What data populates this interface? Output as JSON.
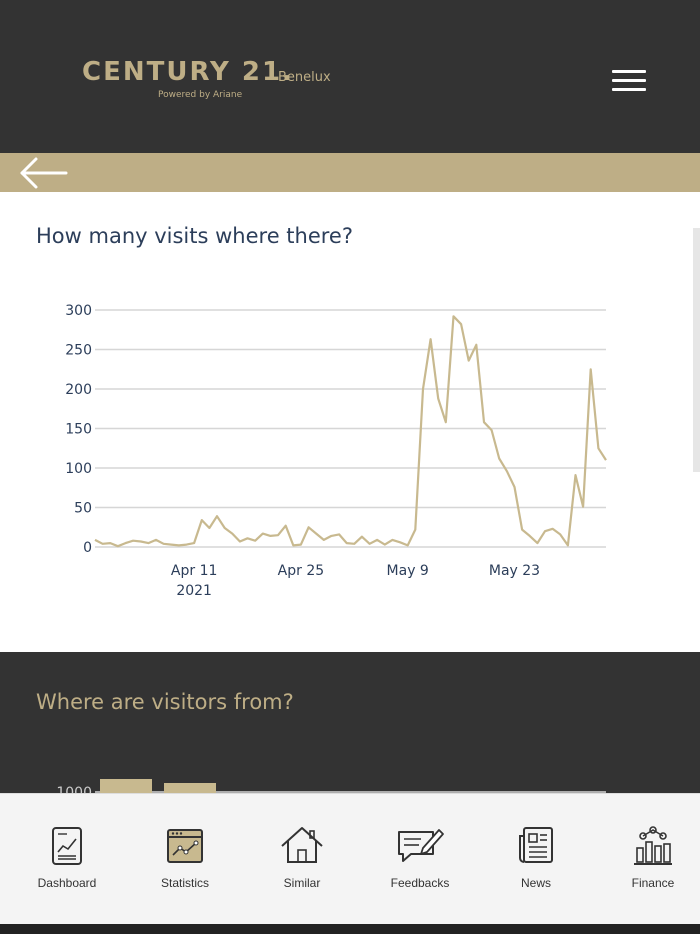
{
  "header": {
    "logo_main": "CENTURY 21.",
    "logo_region": "Benelux",
    "logo_powered": "Powered by Ariane",
    "menu_icon": "hamburger-icon",
    "background": "#333333",
    "accent": "#beae86"
  },
  "back_bar": {
    "icon": "back-arrow-icon"
  },
  "visits_section": {
    "title": "How many visits where there?"
  },
  "chart_data": {
    "type": "line",
    "title": "",
    "xlabel": "",
    "ylabel": "",
    "ylim": [
      0,
      300
    ],
    "yticks": [
      "0",
      "50",
      "100",
      "150",
      "200",
      "250",
      "300"
    ],
    "xticks": [
      {
        "date": "2021-04-11",
        "label": "Apr 11",
        "sublabel": "2021"
      },
      {
        "date": "2021-04-25",
        "label": "Apr 25",
        "sublabel": ""
      },
      {
        "date": "2021-05-09",
        "label": "May 9",
        "sublabel": ""
      },
      {
        "date": "2021-05-23",
        "label": "May 23",
        "sublabel": ""
      }
    ],
    "grid": true,
    "color": "#c8b98f",
    "x": [
      "2021-03-29",
      "2021-03-30",
      "2021-03-31",
      "2021-04-01",
      "2021-04-02",
      "2021-04-03",
      "2021-04-04",
      "2021-04-05",
      "2021-04-06",
      "2021-04-07",
      "2021-04-08",
      "2021-04-09",
      "2021-04-10",
      "2021-04-11",
      "2021-04-12",
      "2021-04-13",
      "2021-04-14",
      "2021-04-15",
      "2021-04-16",
      "2021-04-17",
      "2021-04-18",
      "2021-04-19",
      "2021-04-20",
      "2021-04-21",
      "2021-04-22",
      "2021-04-23",
      "2021-04-24",
      "2021-04-25",
      "2021-04-26",
      "2021-04-27",
      "2021-04-28",
      "2021-04-29",
      "2021-04-30",
      "2021-05-01",
      "2021-05-02",
      "2021-05-03",
      "2021-05-04",
      "2021-05-05",
      "2021-05-06",
      "2021-05-07",
      "2021-05-08",
      "2021-05-09",
      "2021-05-10",
      "2021-05-11",
      "2021-05-12",
      "2021-05-13",
      "2021-05-14",
      "2021-05-15",
      "2021-05-16",
      "2021-05-17",
      "2021-05-18",
      "2021-05-19",
      "2021-05-20",
      "2021-05-21",
      "2021-05-22",
      "2021-05-23",
      "2021-05-24",
      "2021-05-25",
      "2021-05-26",
      "2021-05-27",
      "2021-05-28",
      "2021-05-29",
      "2021-05-30",
      "2021-05-31",
      "2021-06-01",
      "2021-06-02",
      "2021-06-03",
      "2021-06-04"
    ],
    "values": [
      9,
      4,
      5,
      1,
      5,
      8,
      7,
      5,
      9,
      4,
      3,
      2,
      3,
      5,
      34,
      24,
      39,
      24,
      17,
      7,
      11,
      8,
      17,
      14,
      15,
      27,
      2,
      3,
      25,
      17,
      9,
      14,
      16,
      5,
      4,
      13,
      4,
      9,
      3,
      9,
      6,
      2,
      22,
      200,
      263,
      188,
      158,
      292,
      282,
      236,
      256,
      158,
      148,
      112,
      96,
      76,
      22,
      14,
      5,
      20,
      23,
      16,
      2,
      91,
      51,
      225,
      125,
      110
    ]
  },
  "visitors_section": {
    "title": "Where are visitors from?",
    "partial_axis_label": "1000",
    "partial_bars": [
      1000,
      1000
    ]
  },
  "bottom_nav": {
    "items": [
      {
        "label": "Dashboard",
        "icon": "dashboard-icon"
      },
      {
        "label": "Statistics",
        "icon": "statistics-icon"
      },
      {
        "label": "Similar",
        "icon": "house-icon"
      },
      {
        "label": "Feedbacks",
        "icon": "feedback-icon"
      },
      {
        "label": "News",
        "icon": "news-icon"
      },
      {
        "label": "Finance",
        "icon": "finance-icon"
      }
    ]
  }
}
